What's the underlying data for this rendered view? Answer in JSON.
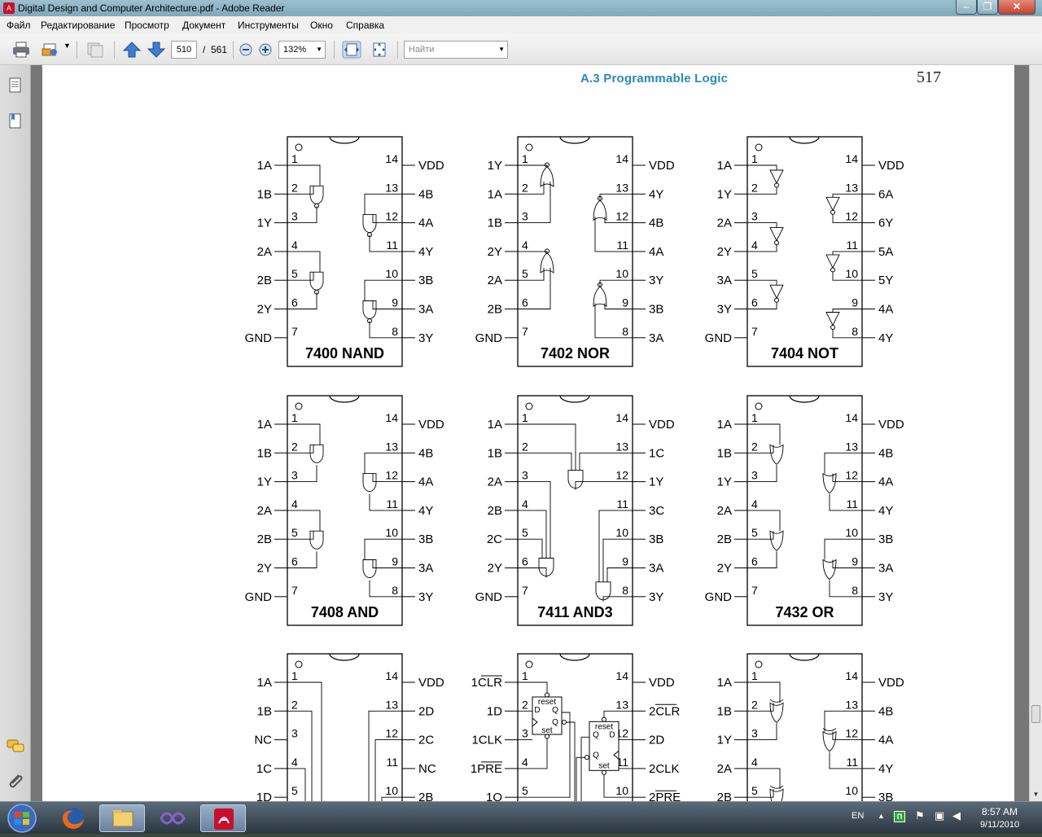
{
  "window": {
    "title": "Digital Design and Computer Architecture.pdf - Adobe Reader"
  },
  "menu": [
    "Файл",
    "Редактирование",
    "Просмотр",
    "Документ",
    "Инструменты",
    "Окно",
    "Справка"
  ],
  "toolbar": {
    "page_current": "510",
    "page_sep": "/",
    "page_total": "561",
    "zoom": "132%",
    "search_placeholder": "Найти"
  },
  "page_header": {
    "section": "A.3 Programmable Logic",
    "page_number": "517"
  },
  "chips": [
    {
      "title": "7400 NAND",
      "gate": "nand",
      "left": [
        "1A",
        "1B",
        "1Y",
        "2A",
        "2B",
        "2Y",
        "GND"
      ],
      "right": [
        "VDD",
        "4B",
        "4A",
        "4Y",
        "3B",
        "3A",
        "3Y"
      ]
    },
    {
      "title": "7402 NOR",
      "gate": "nor",
      "left": [
        "1Y",
        "1A",
        "1B",
        "2Y",
        "2A",
        "2B",
        "GND"
      ],
      "right": [
        "VDD",
        "4Y",
        "4B",
        "4A",
        "3Y",
        "3B",
        "3A"
      ]
    },
    {
      "title": "7404 NOT",
      "gate": "not",
      "left": [
        "1A",
        "1Y",
        "2A",
        "2Y",
        "3A",
        "3Y",
        "GND"
      ],
      "right": [
        "VDD",
        "6A",
        "6Y",
        "5A",
        "5Y",
        "4A",
        "4Y"
      ]
    },
    {
      "title": "7408 AND",
      "gate": "and",
      "left": [
        "1A",
        "1B",
        "1Y",
        "2A",
        "2B",
        "2Y",
        "GND"
      ],
      "right": [
        "VDD",
        "4B",
        "4A",
        "4Y",
        "3B",
        "3A",
        "3Y"
      ]
    },
    {
      "title": "7411 AND3",
      "gate": "and3",
      "left": [
        "1A",
        "1B",
        "2A",
        "2B",
        "2C",
        "2Y",
        "GND"
      ],
      "right": [
        "VDD",
        "1C",
        "1Y",
        "3C",
        "3B",
        "3A",
        "3Y"
      ]
    },
    {
      "title": "7432 OR",
      "gate": "or",
      "left": [
        "1A",
        "1B",
        "1Y",
        "2A",
        "2B",
        "2Y",
        "GND"
      ],
      "right": [
        "VDD",
        "4B",
        "4A",
        "4Y",
        "3B",
        "3A",
        "3Y"
      ]
    },
    {
      "title": "",
      "gate": "mux",
      "left": [
        "1A",
        "1B",
        "NC",
        "1C",
        "1D"
      ],
      "right": [
        "VDD",
        "2D",
        "2C",
        "NC",
        "2B"
      ]
    },
    {
      "title": "",
      "gate": "dff",
      "left": [
        "1CLR",
        "1D",
        "1CLK",
        "1PRE",
        "1Q"
      ],
      "right": [
        "VDD",
        "2CLR",
        "2D",
        "2CLK",
        "2PRE"
      ],
      "ff_labels": {
        "reset": "reset",
        "set": "set",
        "d": "D",
        "q": "Q"
      }
    },
    {
      "title": "",
      "gate": "xor",
      "left": [
        "1A",
        "1B",
        "1Y",
        "2A",
        "2B"
      ],
      "right": [
        "VDD",
        "4B",
        "4A",
        "4Y",
        "3B"
      ]
    }
  ],
  "pin_numbers_left": [
    "1",
    "2",
    "3",
    "4",
    "5",
    "6",
    "7"
  ],
  "pin_numbers_right": [
    "14",
    "13",
    "12",
    "11",
    "10",
    "9",
    "8"
  ],
  "tray": {
    "lang": "EN",
    "time": "8:57 AM",
    "date": "9/11/2010"
  },
  "icons": [
    "adobe-pdf-icon",
    "print-icon",
    "email-icon",
    "collaborate-icon",
    "prev-page-icon",
    "next-page-icon",
    "zoom-out-icon",
    "zoom-in-icon",
    "fit-page-icon",
    "fit-width-icon",
    "pages-panel-icon",
    "bookmarks-icon",
    "comments-icon",
    "attachments-icon",
    "windows-start-icon",
    "firefox-icon",
    "explorer-icon",
    "visual-studio-icon",
    "adobe-reader-icon"
  ]
}
